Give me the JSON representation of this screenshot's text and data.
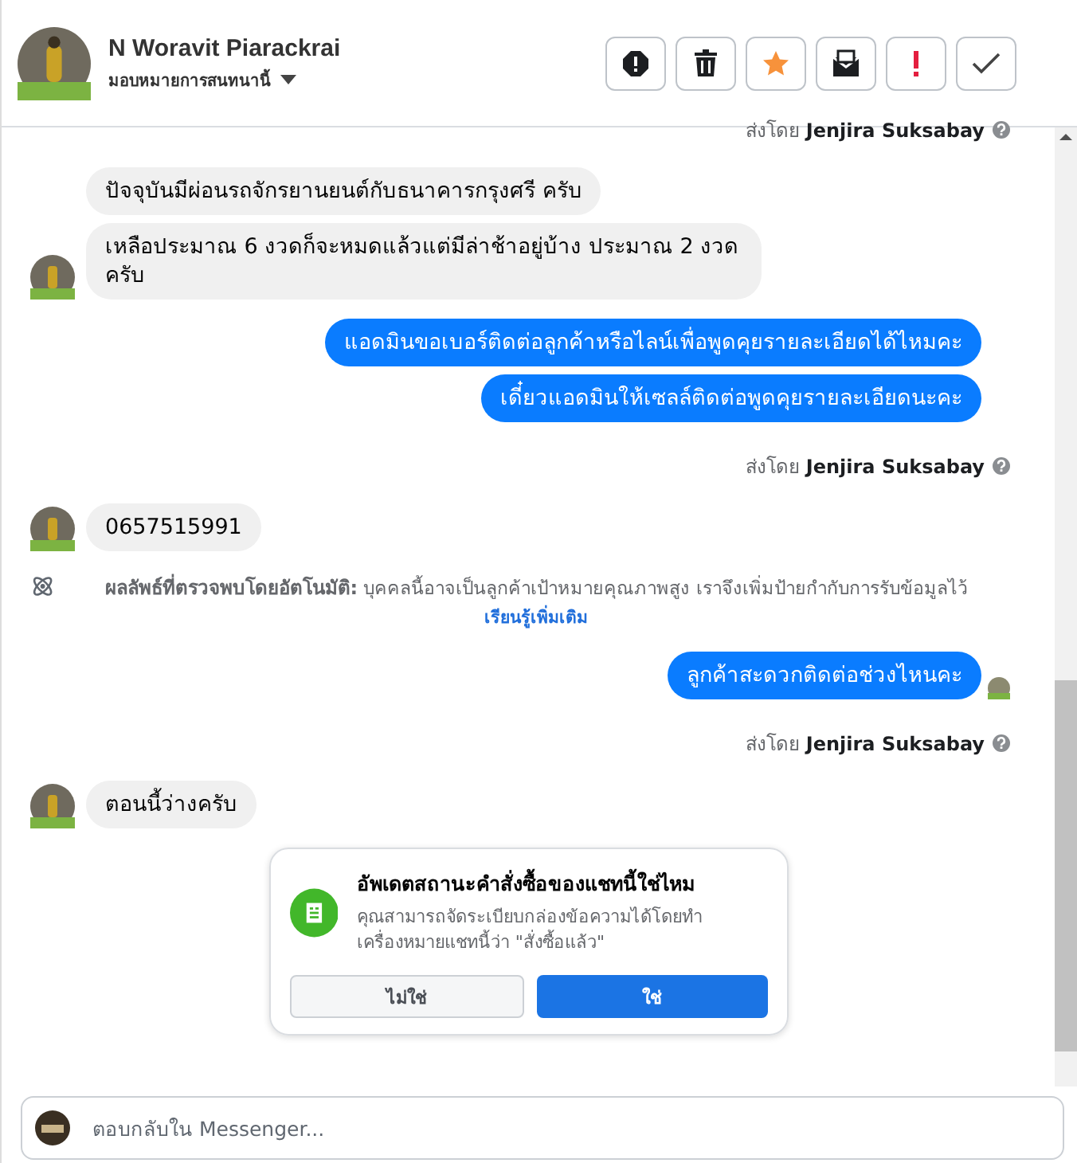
{
  "header": {
    "name": "N Woravit Piarackrai",
    "assign": "มอบหมายการสนทนานี้",
    "actions": [
      {
        "kind": "block"
      },
      {
        "kind": "delete"
      },
      {
        "kind": "star"
      },
      {
        "kind": "unread"
      },
      {
        "kind": "important"
      },
      {
        "kind": "done"
      }
    ]
  },
  "messages": [
    {
      "kind": "sent_by",
      "prefix": "ส่งโดย",
      "name": "Jenjira Suksabay"
    },
    {
      "kind": "incoming",
      "texts": [
        "ปัจจุบันมีผ่อนรถจักรยานยนต์กับธนาคารกรุงศรี ครับ",
        "เหลือประมาณ 6 งวดก็จะหมดแล้วแต่มีล่าช้าอยู่บ้าง ประมาณ 2 งวด ครับ"
      ]
    },
    {
      "kind": "outgoing",
      "texts": [
        "แอดมินขอเบอร์ติดต่อลูกค้าหรือไลน์เพื่อพูดคุยรายละเอียดได้ไหมคะ",
        "เดี๋ยวแอดมินให้เซลล์ติดต่อพูดคุยรายละเอียดนะคะ"
      ],
      "seen": false
    },
    {
      "kind": "sent_by",
      "prefix": "ส่งโดย",
      "name": "Jenjira Suksabay"
    },
    {
      "kind": "incoming",
      "texts": [
        "0657515991"
      ]
    },
    {
      "kind": "notice",
      "text": "**ผลลัพธ์ที่ตรวจพบโดยอัตโนมัติ:** บุคคลนี้อาจเป็นลูกค้าเป้าหมายคุณภาพสูง เราจึงเพิ่มป้ายกำกับการรับข้อมูลไว้",
      "link": "เรียนรู้เพิ่มเติม"
    },
    {
      "kind": "outgoing",
      "texts": [
        "ลูกค้าสะดวกติดต่อช่วงไหนคะ"
      ],
      "seen": true
    },
    {
      "kind": "sent_by",
      "prefix": "ส่งโดย",
      "name": "Jenjira Suksabay"
    },
    {
      "kind": "incoming",
      "texts": [
        "ตอนนี้ว่างครับ"
      ]
    }
  ],
  "card": {
    "title": "อัพเดตสถานะคำสั่งซื้อของแชทนี้ใช่ไหม",
    "text": "คุณสามารถจัดระเบียบกล่องข้อความได้โดยทำเครื่องหมายแชทนี้ว่า \"สั่งซื้อแล้ว\"",
    "no": "ไม่ใช่",
    "yes": "ใช่"
  },
  "composer": {
    "placeholder": "ตอบกลับใน Messenger..."
  }
}
